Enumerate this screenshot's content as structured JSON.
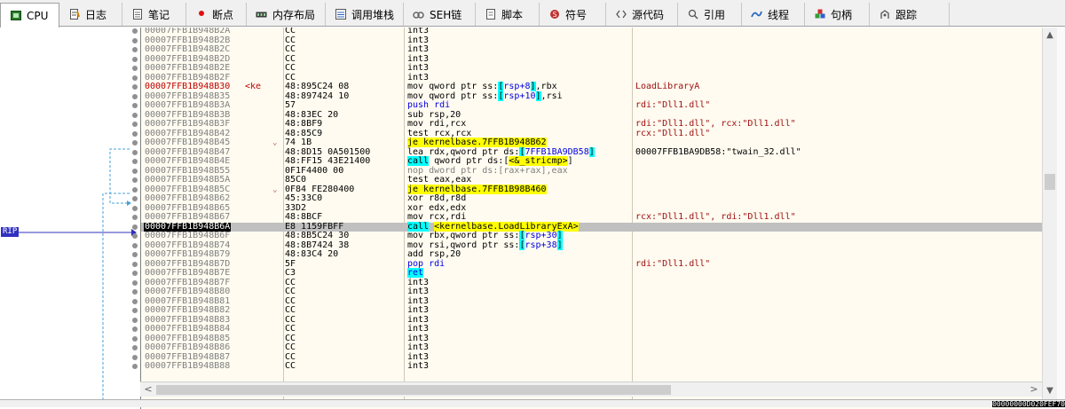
{
  "tabs": [
    {
      "label": "CPU",
      "icon": "cpu-icon",
      "active": true
    },
    {
      "label": "日志",
      "icon": "log-icon"
    },
    {
      "label": "笔记",
      "icon": "notes-icon"
    },
    {
      "label": "断点",
      "icon": "breakpoint-icon"
    },
    {
      "label": "内存布局",
      "icon": "memory-map-icon"
    },
    {
      "label": "调用堆栈",
      "icon": "call-stack-icon"
    },
    {
      "label": "SEH链",
      "icon": "seh-chain-icon"
    },
    {
      "label": "脚本",
      "icon": "script-icon"
    },
    {
      "label": "符号",
      "icon": "symbols-icon"
    },
    {
      "label": "源代码",
      "icon": "source-code-icon"
    },
    {
      "label": "引用",
      "icon": "references-icon"
    },
    {
      "label": "线程",
      "icon": "threads-icon"
    },
    {
      "label": "句柄",
      "icon": "handles-icon"
    },
    {
      "label": "跟踪",
      "icon": "trace-icon"
    }
  ],
  "rip_label": "RIP",
  "rows": [
    {
      "addr": "00007FFB1B948B2A",
      "bytes": "CC",
      "instr": [
        {
          "t": "int3"
        }
      ],
      "cmt": ""
    },
    {
      "addr": "00007FFB1B948B2B",
      "bytes": "CC",
      "instr": [
        {
          "t": "int3"
        }
      ],
      "cmt": ""
    },
    {
      "addr": "00007FFB1B948B2C",
      "bytes": "CC",
      "instr": [
        {
          "t": "int3"
        }
      ],
      "cmt": ""
    },
    {
      "addr": "00007FFB1B948B2D",
      "bytes": "CC",
      "instr": [
        {
          "t": "int3"
        }
      ],
      "cmt": ""
    },
    {
      "addr": "00007FFB1B948B2E",
      "bytes": "CC",
      "instr": [
        {
          "t": "int3"
        }
      ],
      "cmt": ""
    },
    {
      "addr": "00007FFB1B948B2F",
      "bytes": "CC",
      "instr": [
        {
          "t": "int3"
        }
      ],
      "cmt": ""
    },
    {
      "addr": "00007FFB1B948B30",
      "bp": true,
      "label": "<ke",
      "bytes": "48:895C24 08",
      "instr": [
        {
          "t": "mov qword ptr ss:"
        },
        {
          "t": "[",
          "c": "hl-c"
        },
        {
          "t": "rsp+8",
          "c": "reg"
        },
        {
          "t": "]",
          "c": "hl-c"
        },
        {
          "t": ",rbx"
        }
      ],
      "cmt": "LoadLibraryA"
    },
    {
      "addr": "00007FFB1B948B35",
      "bytes": "48:897424 10",
      "instr": [
        {
          "t": "mov qword ptr ss:"
        },
        {
          "t": "[",
          "c": "hl-c"
        },
        {
          "t": "rsp+10",
          "c": "reg"
        },
        {
          "t": "]",
          "c": "hl-c"
        },
        {
          "t": ",rsi"
        }
      ],
      "cmt": ""
    },
    {
      "addr": "00007FFB1B948B3A",
      "bytes": "57",
      "instr": [
        {
          "t": "push rdi",
          "c": "k-push"
        }
      ],
      "cmt": "rdi:\"Dll1.dll\""
    },
    {
      "addr": "00007FFB1B948B3B",
      "bytes": "48:83EC 20",
      "instr": [
        {
          "t": "sub rsp,20"
        }
      ],
      "cmt": ""
    },
    {
      "addr": "00007FFB1B948B3F",
      "bytes": "48:8BF9",
      "instr": [
        {
          "t": "mov rdi,rcx"
        }
      ],
      "cmt": "rdi:\"Dll1.dll\", rcx:\"Dll1.dll\""
    },
    {
      "addr": "00007FFB1B948B42",
      "bytes": "48:85C9",
      "instr": [
        {
          "t": "test rcx,rcx"
        }
      ],
      "cmt": "rcx:\"Dll1.dll\""
    },
    {
      "addr": "00007FFB1B948B45",
      "arrow": "⌄",
      "bytes": "74 1B",
      "instr": [
        {
          "t": "je kernelbase.7FFB1B948B62",
          "c": "hl-y"
        }
      ],
      "cmt": ""
    },
    {
      "addr": "00007FFB1B948B47",
      "bytes": "48:8D15 0A501500",
      "instr": [
        {
          "t": "lea rdx,qword ptr ds:"
        },
        {
          "t": "[",
          "c": "hl-c"
        },
        {
          "t": "7FFB1BA9DB58",
          "c": "reg"
        },
        {
          "t": "]",
          "c": "hl-c"
        }
      ],
      "cmt": "00007FFB1BA9DB58:\"twain_32.dll\"",
      "cmtblk": true
    },
    {
      "addr": "00007FFB1B948B4E",
      "bytes": "48:FF15 43E21400",
      "instr": [
        {
          "t": "call",
          "c": "hl-c"
        },
        {
          "t": " qword ptr ds:["
        },
        {
          "t": "<&_stricmp>",
          "c": "hl-y"
        },
        {
          "t": "]"
        }
      ],
      "cmt": ""
    },
    {
      "addr": "00007FFB1B948B55",
      "bytes": "0F1F4400 00",
      "instr": [
        {
          "t": "nop dword ptr ds:[rax+rax],eax",
          "c": "k-nop"
        }
      ],
      "cmt": ""
    },
    {
      "addr": "00007FFB1B948B5A",
      "bytes": "85C0",
      "instr": [
        {
          "t": "test eax,eax"
        }
      ],
      "cmt": ""
    },
    {
      "addr": "00007FFB1B948B5C",
      "arrow": "⌄",
      "bytes": "0F84 FE280400",
      "instr": [
        {
          "t": "je kernelbase.7FFB1B98B460",
          "c": "hl-y"
        }
      ],
      "cmt": ""
    },
    {
      "addr": "00007FFB1B948B62",
      "bytes": "45:33C0",
      "instr": [
        {
          "t": "xor r8d,r8d"
        }
      ],
      "cmt": ""
    },
    {
      "addr": "00007FFB1B948B65",
      "bytes": "33D2",
      "instr": [
        {
          "t": "xor edx,edx"
        }
      ],
      "cmt": ""
    },
    {
      "addr": "00007FFB1B948B67",
      "bytes": "48:8BCF",
      "instr": [
        {
          "t": "mov rcx,rdi"
        }
      ],
      "cmt": "rcx:\"Dll1.dll\", rdi:\"Dll1.dll\""
    },
    {
      "addr": "00007FFB1B948B6A",
      "cur": true,
      "bytes": "E8 1159FBFF",
      "instr": [
        {
          "t": "call",
          "c": "hl-c"
        },
        {
          "t": " "
        },
        {
          "t": "<kernelbase.LoadLibraryExA>",
          "c": "hl-y"
        }
      ],
      "cmt": ""
    },
    {
      "addr": "00007FFB1B948B6F",
      "bytes": "48:8B5C24 30",
      "instr": [
        {
          "t": "mov rbx,qword ptr ss:"
        },
        {
          "t": "[",
          "c": "hl-c"
        },
        {
          "t": "rsp+30",
          "c": "reg"
        },
        {
          "t": "]",
          "c": "hl-c"
        }
      ],
      "cmt": ""
    },
    {
      "addr": "00007FFB1B948B74",
      "bytes": "48:8B7424 38",
      "instr": [
        {
          "t": "mov rsi,qword ptr ss:"
        },
        {
          "t": "[",
          "c": "hl-c"
        },
        {
          "t": "rsp+38",
          "c": "reg"
        },
        {
          "t": "]",
          "c": "hl-c"
        }
      ],
      "cmt": ""
    },
    {
      "addr": "00007FFB1B948B79",
      "bytes": "48:83C4 20",
      "instr": [
        {
          "t": "add rsp,20"
        }
      ],
      "cmt": ""
    },
    {
      "addr": "00007FFB1B948B7D",
      "bytes": "5F",
      "instr": [
        {
          "t": "pop rdi",
          "c": "k-push"
        }
      ],
      "cmt": "rdi:\"Dll1.dll\""
    },
    {
      "addr": "00007FFB1B948B7E",
      "bytes": "C3",
      "instr": [
        {
          "t": "ret",
          "c": "k-ret"
        }
      ],
      "cmt": ""
    },
    {
      "addr": "00007FFB1B948B7F",
      "bytes": "CC",
      "instr": [
        {
          "t": "int3"
        }
      ],
      "cmt": ""
    },
    {
      "addr": "00007FFB1B948B80",
      "bytes": "CC",
      "instr": [
        {
          "t": "int3"
        }
      ],
      "cmt": ""
    },
    {
      "addr": "00007FFB1B948B81",
      "bytes": "CC",
      "instr": [
        {
          "t": "int3"
        }
      ],
      "cmt": ""
    },
    {
      "addr": "00007FFB1B948B82",
      "bytes": "CC",
      "instr": [
        {
          "t": "int3"
        }
      ],
      "cmt": ""
    },
    {
      "addr": "00007FFB1B948B83",
      "bytes": "CC",
      "instr": [
        {
          "t": "int3"
        }
      ],
      "cmt": ""
    },
    {
      "addr": "00007FFB1B948B84",
      "bytes": "CC",
      "instr": [
        {
          "t": "int3"
        }
      ],
      "cmt": ""
    },
    {
      "addr": "00007FFB1B948B85",
      "bytes": "CC",
      "instr": [
        {
          "t": "int3"
        }
      ],
      "cmt": ""
    },
    {
      "addr": "00007FFB1B948B86",
      "bytes": "CC",
      "instr": [
        {
          "t": "int3"
        }
      ],
      "cmt": ""
    },
    {
      "addr": "00007FFB1B948B87",
      "bytes": "CC",
      "instr": [
        {
          "t": "int3"
        }
      ],
      "cmt": ""
    },
    {
      "addr": "00007FFB1B948B88",
      "bytes": "CC",
      "instr": [
        {
          "t": "int3"
        }
      ],
      "cmt": ""
    }
  ],
  "status_right": "00000000D020FEF70"
}
